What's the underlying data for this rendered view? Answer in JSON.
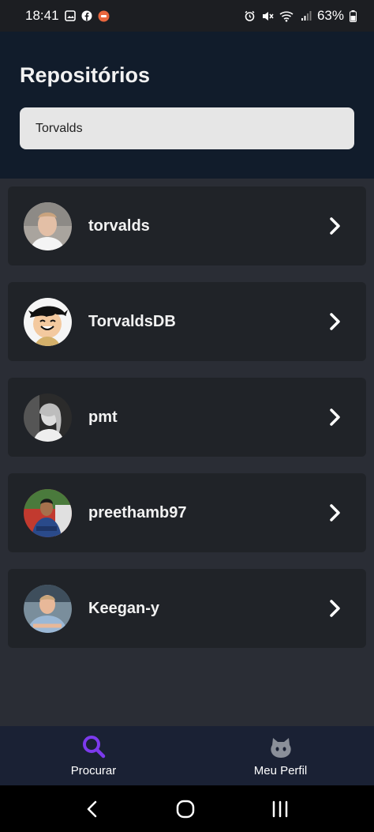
{
  "status_bar": {
    "time": "18:41",
    "battery": "63%",
    "icons": [
      "image-icon",
      "facebook-icon",
      "app-notification-icon",
      "alarm-icon",
      "mute-icon",
      "wifi-icon",
      "signal-icon",
      "battery-icon"
    ]
  },
  "header": {
    "title": "Repositórios",
    "search": {
      "value": "Torvalds",
      "placeholder": ""
    }
  },
  "users": [
    {
      "username": "torvalds"
    },
    {
      "username": "TorvaldsDB"
    },
    {
      "username": "pmt"
    },
    {
      "username": "preethamb97"
    },
    {
      "username": "Keegan-y"
    }
  ],
  "bottom_nav": {
    "items": [
      {
        "label": "Procurar",
        "icon": "search-icon",
        "active": true
      },
      {
        "label": "Meu Perfil",
        "icon": "github-icon",
        "active": false
      }
    ]
  },
  "colors": {
    "accent": "#7c3aed",
    "header_bg": "#111c2b",
    "body_bg": "#2a2d35",
    "card_bg": "#202328"
  }
}
